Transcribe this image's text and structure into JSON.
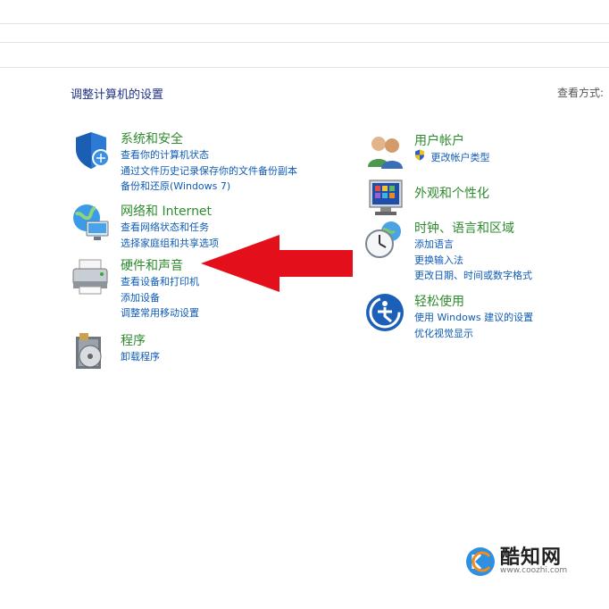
{
  "header": {
    "title": "调整计算机的设置",
    "view_by": "查看方式:"
  },
  "categories_left": [
    {
      "title": "系统和安全",
      "icon": "shield-icon",
      "links": [
        "查看你的计算机状态",
        "通过文件历史记录保存你的文件备份副本",
        "备份和还原(Windows 7)"
      ]
    },
    {
      "title": "网络和 Internet",
      "icon": "network-globe-icon",
      "links": [
        "查看网络状态和任务",
        "选择家庭组和共享选项"
      ]
    },
    {
      "title": "硬件和声音",
      "icon": "printer-icon",
      "links": [
        "查看设备和打印机",
        "添加设备",
        "调整常用移动设置"
      ]
    },
    {
      "title": "程序",
      "icon": "programs-disc-icon",
      "links": [
        "卸载程序"
      ]
    }
  ],
  "categories_right": [
    {
      "title": "用户帐户",
      "icon": "users-icon",
      "links": [
        "更改帐户类型"
      ]
    },
    {
      "title": "外观和个性化",
      "icon": "monitor-palette-icon",
      "links": []
    },
    {
      "title": "时钟、语言和区域",
      "icon": "clock-globe-icon",
      "links": [
        "添加语言",
        "更换输入法",
        "更改日期、时间或数字格式"
      ]
    },
    {
      "title": "轻松使用",
      "icon": "ease-of-access-icon",
      "links": [
        "使用 Windows 建议的设置",
        "优化视觉显示"
      ]
    }
  ],
  "annotation": {
    "arrow_color": "#e3101b"
  },
  "watermark": {
    "brand": "酷知网",
    "url": "www.coozhi.com"
  }
}
